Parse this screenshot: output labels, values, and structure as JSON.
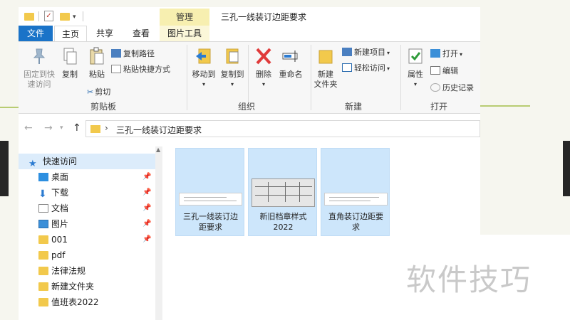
{
  "window": {
    "title": "三孔一线装订边距要求",
    "contextual_tab_group": "管理"
  },
  "tabs": [
    "文件",
    "主页",
    "共享",
    "查看",
    "图片工具"
  ],
  "ribbon": {
    "clipboard": {
      "label": "剪贴板",
      "pin_quick_access": [
        "固定到快",
        "速访问"
      ],
      "copy": "复制",
      "paste": "粘贴",
      "copy_path": "复制路径",
      "paste_shortcut": "粘贴快捷方式",
      "cut": "剪切"
    },
    "organize": {
      "label": "组织",
      "move_to": "移动到",
      "copy_to": "复制到",
      "delete": "删除",
      "rename": "重命名"
    },
    "new": {
      "label": "新建",
      "new_folder": [
        "新建",
        "文件夹"
      ],
      "new_item": "新建项目",
      "easy_access": "轻松访问"
    },
    "open": {
      "label": "打开",
      "properties": "属性",
      "open": "打开",
      "edit": "编辑",
      "history": "历史记录"
    }
  },
  "address": {
    "path": "三孔一线装订边距要求"
  },
  "nav_pane": {
    "quick_access": "快速访问",
    "items": [
      {
        "label": "桌面",
        "icon": "desktop-icon",
        "pinned": true
      },
      {
        "label": "下载",
        "icon": "download-icon",
        "pinned": true
      },
      {
        "label": "文档",
        "icon": "document-icon",
        "pinned": true
      },
      {
        "label": "图片",
        "icon": "pictures-icon",
        "pinned": true
      },
      {
        "label": "001",
        "icon": "folder-icon",
        "pinned": true
      },
      {
        "label": "pdf",
        "icon": "folder-icon",
        "pinned": false
      },
      {
        "label": "法律法规",
        "icon": "folder-icon",
        "pinned": false
      },
      {
        "label": "新建文件夹",
        "icon": "folder-icon",
        "pinned": false
      },
      {
        "label": "值班表2022",
        "icon": "folder-icon",
        "pinned": false
      }
    ]
  },
  "files": [
    {
      "name_lines": [
        "三孔一线装订边",
        "距要求"
      ]
    },
    {
      "name_lines": [
        "新旧档章样式",
        "2022"
      ]
    },
    {
      "name_lines": [
        "直角装订边距要",
        "求"
      ]
    }
  ],
  "watermark": "软件技巧",
  "colors": {
    "file_tab": "#1a73c8",
    "manage_tab": "#f7efb0",
    "selection": "#cde6fb",
    "folder": "#f2c94c",
    "slide_background": "#f6f6ef",
    "accent_line": "#b8cc72"
  }
}
